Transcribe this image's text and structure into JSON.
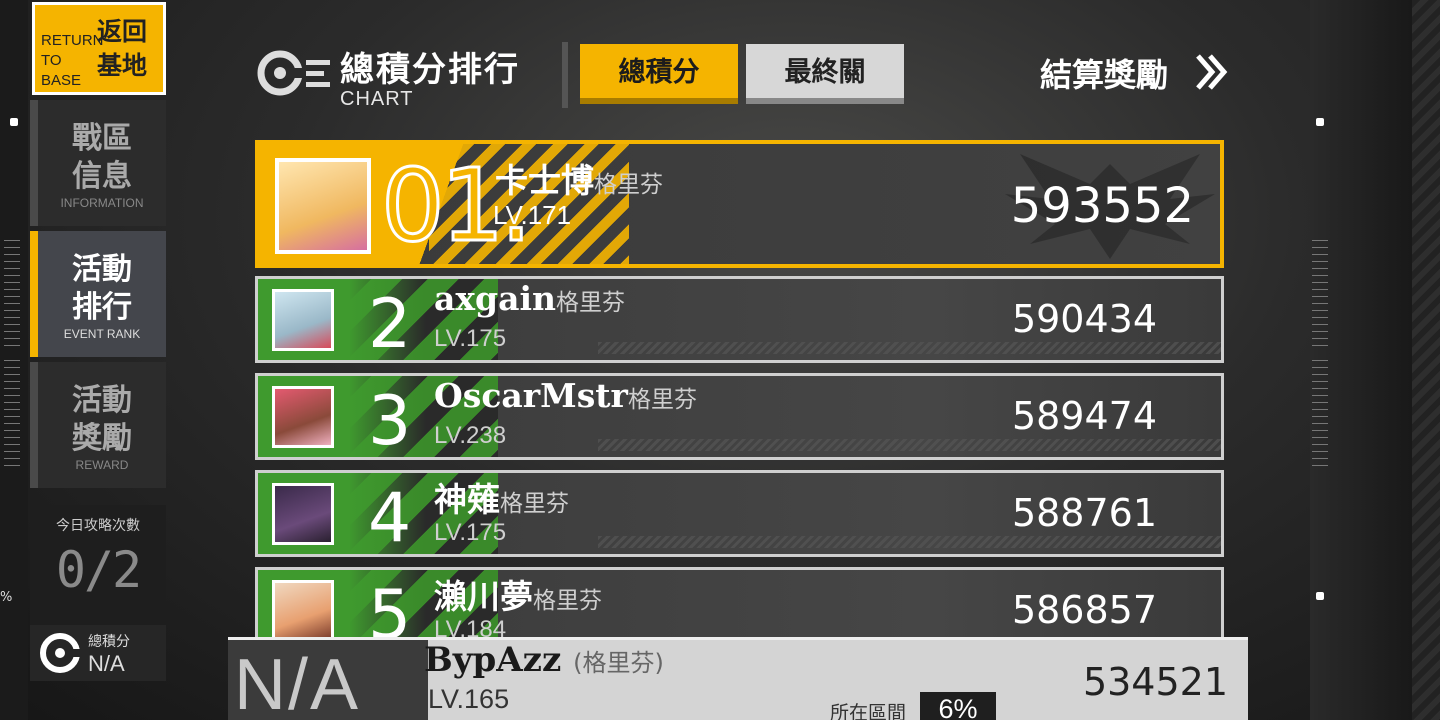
{
  "sidebar": {
    "return_en": "RETURN TO BASE",
    "return_zh": "返回基地",
    "items": [
      {
        "zh": "戰區信息",
        "en": "INFORMATION",
        "active": false
      },
      {
        "zh": "活動排行",
        "en": "EVENT RANK",
        "active": true
      },
      {
        "zh": "活動獎勵",
        "en": "REWARD",
        "active": false
      }
    ],
    "attempts_label": "今日攻略次數",
    "attempts_value": "0/2",
    "mini_label": "總積分",
    "mini_value": "N/A"
  },
  "header": {
    "title_zh": "總積分排行",
    "title_en": "CHART",
    "tab_total": "總積分",
    "tab_final": "最終關",
    "settle": "結算獎勵"
  },
  "ranks": [
    {
      "rank": "01.",
      "name": "卡士博",
      "guild": "格里芬",
      "lv": "LV.171",
      "score": "593552"
    },
    {
      "rank": "2",
      "name": "axgain",
      "guild": "格里芬",
      "lv": "LV.175",
      "score": "590434"
    },
    {
      "rank": "3",
      "name": "OscarMstr",
      "guild": "格里芬",
      "lv": "LV.238",
      "score": "589474"
    },
    {
      "rank": "4",
      "name": "神薙",
      "guild": "格里芬",
      "lv": "LV.175",
      "score": "588761"
    },
    {
      "rank": "5",
      "name": "瀨川夢",
      "guild": "格里芬",
      "lv": "LV.184",
      "score": "586857"
    }
  ],
  "self": {
    "rank": "N/A",
    "name": "BypAzz",
    "guild": "(格里芬)",
    "lv": "LV.165",
    "score": "534521",
    "range_label": "所在區間",
    "range_value": "6%"
  },
  "colors": {
    "accent": "#f5b400",
    "green": "#3f9a2e"
  }
}
